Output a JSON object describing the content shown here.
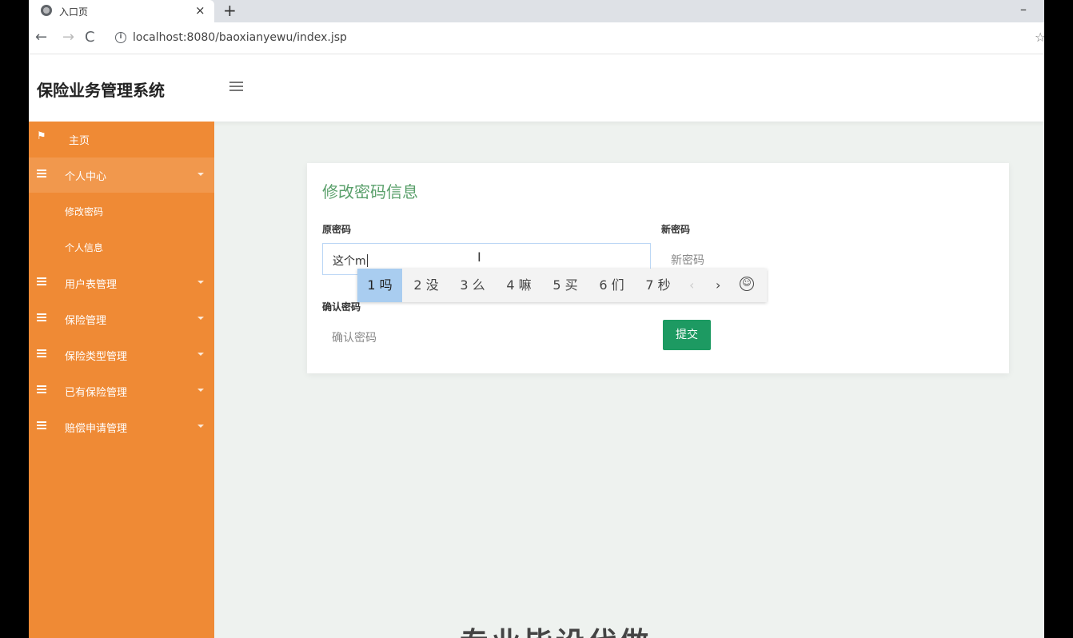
{
  "browser": {
    "tab_title": "入口页",
    "tab_close": "×",
    "new_tab": "+",
    "minimize": "–",
    "url": "localhost:8080/baoxianyewu/index.jsp",
    "back": "←",
    "forward": "→",
    "reload": "C",
    "info": "i",
    "star": "☆"
  },
  "app": {
    "title": "保险业务管理系统"
  },
  "sidebar": {
    "items": [
      {
        "label": "主页",
        "icon": "flag-icon"
      },
      {
        "label": "个人中心",
        "icon": "list-icon",
        "expanded": true
      },
      {
        "label": "用户表管理",
        "icon": "list-icon"
      },
      {
        "label": "保险管理",
        "icon": "list-icon"
      },
      {
        "label": "保险类型管理",
        "icon": "list-icon"
      },
      {
        "label": "已有保险管理",
        "icon": "list-icon"
      },
      {
        "label": "赔偿申请管理",
        "icon": "list-icon"
      }
    ],
    "submenu": [
      {
        "label": "修改密码"
      },
      {
        "label": "个人信息"
      }
    ]
  },
  "form": {
    "title": "修改密码信息",
    "old_password_label": "原密码",
    "old_password_value": "这个m",
    "new_password_label": "新密码",
    "new_password_placeholder": "新密码",
    "confirm_password_label": "确认密码",
    "confirm_password_placeholder": "确认密码",
    "submit_label": "提交"
  },
  "ime": {
    "candidates": [
      "1 吗",
      "2 没",
      "3 么",
      "4 嘛",
      "5 买",
      "6 们",
      "7 秒"
    ],
    "prev": "‹",
    "next": "›",
    "emoji": "☺"
  },
  "background_text": "专业毕设代做",
  "colors": {
    "sidebar": "#ef8a35",
    "accent_title": "#5aa06b",
    "submit": "#1d9a62",
    "ime_selected": "#a9cdf0"
  }
}
